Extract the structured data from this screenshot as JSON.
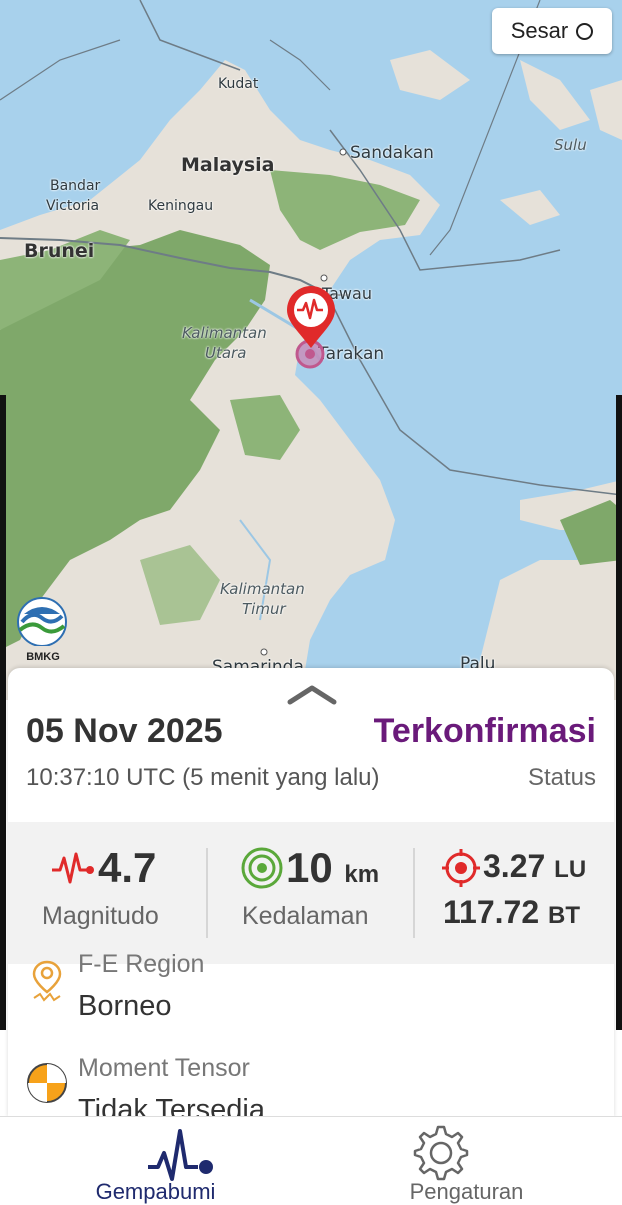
{
  "map": {
    "labels": {
      "kudat": "Kudat",
      "malaysia": "Malaysia",
      "sandakan": "Sandakan",
      "sulu": "Sulu",
      "bandar": "Bandar",
      "victoria": "Victoria",
      "keningau": "Keningau",
      "brunei": "Brunei",
      "tawau": "Tawau",
      "kalimantan_utara_1": "Kalimantan",
      "kalimantan_utara_2": "Utara",
      "tarakan": "Tarakan",
      "kalimantan_timur_1": "Kalimantan",
      "kalimantan_timur_2": "Timur",
      "samarinda": "Samarinda",
      "palu": "Palu"
    },
    "layer_toggle": "Sesar",
    "logo_text": "BMKG",
    "colors": {
      "sea": "#a8d1ec",
      "land": "#e6e1d9",
      "forest": "#7fa86a",
      "pin": "#e02a2a"
    }
  },
  "event": {
    "date": "05 Nov 2025",
    "status": "Terkonfirmasi",
    "time": "10:37:10 UTC",
    "relative": "(5 menit yang lalu)",
    "status_label": "Status",
    "magnitude": "4.7",
    "magnitude_label": "Magnitudo",
    "depth": "10",
    "depth_unit": "km",
    "depth_label": "Kedalaman",
    "lat": "3.27",
    "lat_dir": "LU",
    "lon": "117.72",
    "lon_dir": "BT",
    "region_title": "F-E Region",
    "region_value": "Borneo",
    "mt_title": "Moment Tensor",
    "mt_value": "Tidak Tersedia"
  },
  "nav": {
    "items": [
      {
        "label": "Gempabumi",
        "icon": "seismograph-icon",
        "active": true
      },
      {
        "label": "Pengaturan",
        "icon": "gear-icon",
        "active": false
      }
    ],
    "active_color": "#1f2a6e"
  }
}
